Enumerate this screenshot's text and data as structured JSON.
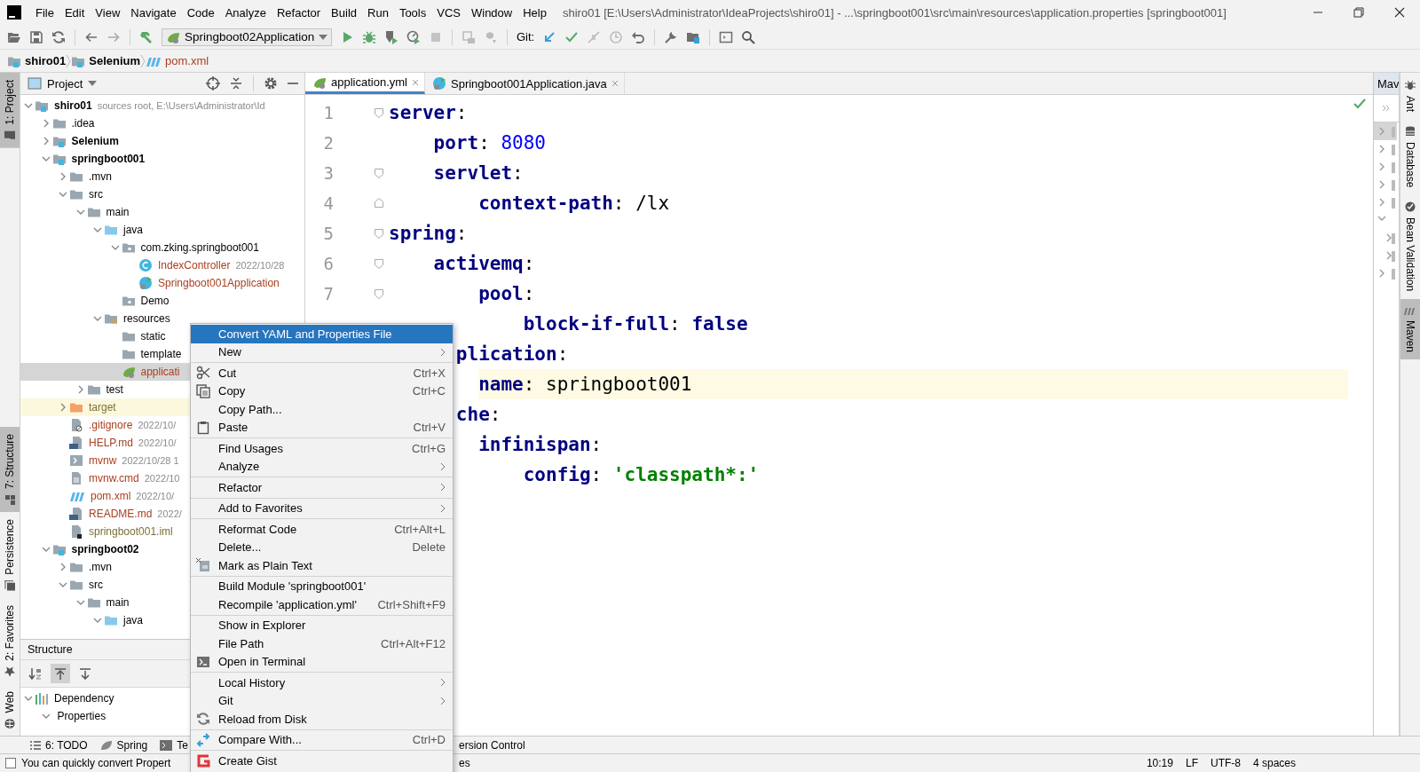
{
  "menu_bar": {
    "items": [
      "File",
      "Edit",
      "View",
      "Navigate",
      "Code",
      "Analyze",
      "Refactor",
      "Build",
      "Run",
      "Tools",
      "VCS",
      "Window",
      "Help"
    ],
    "title": "shiro01 [E:\\Users\\Administrator\\IdeaProjects\\shiro01] - ...\\springboot001\\src\\main\\resources\\application.properties [springboot001]"
  },
  "toolbar": {
    "run_configuration": "Springboot02Application",
    "git_label": "Git:"
  },
  "breadcrumbs": [
    {
      "label": "shiro01",
      "kind": "module"
    },
    {
      "label": "Selenium",
      "kind": "module"
    },
    {
      "label": "pom.xml",
      "kind": "maven"
    }
  ],
  "left_tool_tabs": {
    "top": [
      {
        "label": "1: Project",
        "selected": true
      }
    ],
    "bottom": [
      {
        "label": "7: Structure",
        "selected": true
      },
      {
        "label": "Persistence",
        "selected": false
      },
      {
        "label": "2: Favorites",
        "selected": false
      },
      {
        "label": "Web",
        "selected": false
      }
    ]
  },
  "right_tool_tabs": [
    {
      "label": "Ant",
      "selected": false
    },
    {
      "label": "Database",
      "selected": false
    },
    {
      "label": "Bean Validation",
      "selected": false
    },
    {
      "label": "Maven",
      "selected": true
    }
  ],
  "project_panel": {
    "title": "Project",
    "tree": [
      {
        "label": "shiro01",
        "kind": "module",
        "note": "sources root,  E:\\Users\\Administrator\\Id",
        "expanded": true,
        "selected": false,
        "children": [
          {
            "label": ".idea",
            "kind": "folder",
            "expanded": false,
            "selected": false
          },
          {
            "label": "Selenium",
            "kind": "module",
            "expanded": false,
            "selected": false
          },
          {
            "label": "springboot001",
            "kind": "module",
            "expanded": true,
            "selected": false,
            "children": [
              {
                "label": ".mvn",
                "kind": "folder",
                "expanded": false,
                "selected": false
              },
              {
                "label": "src",
                "kind": "folder",
                "expanded": true,
                "selected": false,
                "children": [
                  {
                    "label": "main",
                    "kind": "folder",
                    "expanded": true,
                    "selected": false,
                    "children": [
                      {
                        "label": "java",
                        "kind": "source",
                        "expanded": true,
                        "selected": false,
                        "children": [
                          {
                            "label": "com.zking.springboot001",
                            "kind": "package",
                            "expanded": true,
                            "selected": false,
                            "children": [
                              {
                                "label": "IndexController",
                                "kind": "class",
                                "color": "#a93f1f",
                                "date": "2022/10/28",
                                "selected": false
                              },
                              {
                                "label": "Springboot001Application",
                                "kind": "app",
                                "color": "#a93f1f",
                                "selected": false
                              }
                            ]
                          },
                          {
                            "label": "Demo",
                            "kind": "package",
                            "selected": false
                          }
                        ]
                      },
                      {
                        "label": "resources",
                        "kind": "resources",
                        "expanded": true,
                        "selected": false,
                        "children": [
                          {
                            "label": "static",
                            "kind": "folder",
                            "selected": false
                          },
                          {
                            "label": "template",
                            "kind": "folder",
                            "selected": false
                          },
                          {
                            "label": "applicati",
                            "kind": "yml",
                            "color": "#a93f1f",
                            "selected": true
                          }
                        ]
                      }
                    ]
                  },
                  {
                    "label": "test",
                    "kind": "folder",
                    "expanded": false,
                    "selected": false
                  }
                ]
              },
              {
                "label": "target",
                "kind": "excluded",
                "color": "#7d6f35",
                "expanded": false,
                "selected": false
              },
              {
                "label": ".gitignore",
                "kind": "gitignore",
                "color": "#a93f1f",
                "date": "2022/10/",
                "selected": false
              },
              {
                "label": "HELP.md",
                "kind": "md",
                "color": "#a93f1f",
                "date": "2022/10/",
                "selected": false
              },
              {
                "label": "mvnw",
                "kind": "mvnw",
                "color": "#a93f1f",
                "date": "2022/10/28 1",
                "selected": false
              },
              {
                "label": "mvnw.cmd",
                "kind": "cmd",
                "color": "#a93f1f",
                "date": "2022/10",
                "selected": false
              },
              {
                "label": "pom.xml",
                "kind": "maven",
                "color": "#a93f1f",
                "date": "2022/10/",
                "selected": false
              },
              {
                "label": "README.md",
                "kind": "md",
                "color": "#a93f1f",
                "date": "2022/",
                "selected": false
              },
              {
                "label": "springboot001.iml",
                "kind": "iml",
                "color": "#7d6f35",
                "selected": false
              }
            ]
          },
          {
            "label": "springboot02",
            "kind": "module",
            "expanded": true,
            "selected": false,
            "children": [
              {
                "label": ".mvn",
                "kind": "folder",
                "expanded": false,
                "selected": false
              },
              {
                "label": "src",
                "kind": "folder",
                "expanded": true,
                "selected": false,
                "children": [
                  {
                    "label": "main",
                    "kind": "folder",
                    "expanded": true,
                    "selected": false,
                    "children": [
                      {
                        "label": "java",
                        "kind": "source",
                        "expanded": true,
                        "selected": false
                      }
                    ]
                  }
                ]
              }
            ]
          }
        ]
      }
    ]
  },
  "structure_panel": {
    "title": "Structure",
    "toolbar": [
      {
        "selected": false
      },
      {
        "selected": true
      },
      {
        "selected": false
      }
    ],
    "tree": [
      {
        "label": "Dependency",
        "kind": "dependency",
        "expanded": true,
        "selected": false,
        "children": [
          {
            "label": "Properties",
            "expanded": true,
            "selected": false
          }
        ]
      }
    ]
  },
  "editor": {
    "tabs": [
      {
        "label": "application.yml",
        "kind": "yml",
        "selected": true
      },
      {
        "label": "Springboot001Application.java",
        "kind": "app",
        "selected": false
      }
    ],
    "lines": [
      {
        "number": "1",
        "fold_marker": {
          "kind": "start"
        },
        "current": false,
        "tokens": [
          {
            "kind": "key",
            "text": "server"
          },
          {
            "kind": "punct",
            "text": ":"
          }
        ],
        "children": [
          {
            "number": "2",
            "current": false,
            "tokens": [
              {
                "kind": "key",
                "text": "port"
              },
              {
                "kind": "punct",
                "text": ": "
              },
              {
                "kind": "number",
                "text": "8080"
              }
            ]
          },
          {
            "number": "3",
            "fold_marker": {
              "kind": "start"
            },
            "current": false,
            "tokens": [
              {
                "kind": "key",
                "text": "servlet"
              },
              {
                "kind": "punct",
                "text": ":"
              }
            ],
            "children": [
              {
                "number": "4",
                "fold_marker": {
                  "kind": "end"
                },
                "current": false,
                "tokens": [
                  {
                    "kind": "key",
                    "text": "context-path"
                  },
                  {
                    "kind": "punct",
                    "text": ": "
                  },
                  {
                    "kind": "plain",
                    "text": "/lx"
                  }
                ]
              }
            ]
          }
        ]
      },
      {
        "number": "5",
        "fold_marker": {
          "kind": "start"
        },
        "current": false,
        "tokens": [
          {
            "kind": "key",
            "text": "spring"
          },
          {
            "kind": "punct",
            "text": ":"
          }
        ],
        "children": [
          {
            "number": "6",
            "fold_marker": {
              "kind": "start"
            },
            "current": false,
            "tokens": [
              {
                "kind": "key",
                "text": "activemq"
              },
              {
                "kind": "punct",
                "text": ":"
              }
            ],
            "children": [
              {
                "number": "7",
                "fold_marker": {
                  "kind": "start"
                },
                "current": false,
                "tokens": [
                  {
                    "kind": "key",
                    "text": "pool"
                  },
                  {
                    "kind": "punct",
                    "text": ":"
                  }
                ],
                "children": [
                  {
                    "current": false,
                    "tokens": [
                      {
                        "kind": "key",
                        "text": "block-if-full"
                      },
                      {
                        "kind": "punct",
                        "text": ": "
                      },
                      {
                        "kind": "keyword",
                        "text": "false"
                      }
                    ]
                  }
                ]
              }
            ]
          },
          {
            "current": false,
            "tokens": [
              {
                "kind": "clipped_key",
                "text": "plication"
              },
              {
                "kind": "punct",
                "text": ":"
              }
            ],
            "children": [
              {
                "current": true,
                "tokens": [
                  {
                    "kind": "key",
                    "text": "name"
                  },
                  {
                    "kind": "punct",
                    "text": ": "
                  },
                  {
                    "kind": "plain",
                    "text": "springboot001"
                  }
                ]
              }
            ]
          },
          {
            "current": false,
            "tokens": [
              {
                "kind": "clipped_key",
                "text": "che"
              },
              {
                "kind": "punct",
                "text": ":"
              }
            ],
            "children": [
              {
                "current": false,
                "tokens": [
                  {
                    "kind": "key",
                    "text": "infinispan"
                  },
                  {
                    "kind": "punct",
                    "text": ":"
                  }
                ],
                "children": [
                  {
                    "current": false,
                    "tokens": [
                      {
                        "kind": "key",
                        "text": "config"
                      },
                      {
                        "kind": "punct",
                        "text": ": "
                      },
                      {
                        "kind": "string",
                        "text": "'classpath*:'"
                      }
                    ]
                  }
                ]
              }
            ]
          }
        ]
      }
    ]
  },
  "maven_panel": {
    "title": "Mav"
  },
  "context_menu": {
    "items": [
      {
        "kind": "item",
        "label": "Convert YAML and Properties File",
        "selected": true,
        "submenu": false
      },
      {
        "kind": "item",
        "label": "New",
        "selected": false,
        "submenu": true
      },
      {
        "kind": "separator"
      },
      {
        "kind": "item",
        "label": "Cut",
        "shortcut": "Ctrl+X",
        "selected": false,
        "submenu": false
      },
      {
        "kind": "item",
        "label": "Copy",
        "shortcut": "Ctrl+C",
        "selected": false,
        "submenu": false
      },
      {
        "kind": "item",
        "label": "Copy Path...",
        "selected": false,
        "submenu": false
      },
      {
        "kind": "item",
        "label": "Paste",
        "shortcut": "Ctrl+V",
        "selected": false,
        "submenu": false
      },
      {
        "kind": "separator"
      },
      {
        "kind": "item",
        "label": "Find Usages",
        "shortcut": "Ctrl+G",
        "selected": false,
        "submenu": false
      },
      {
        "kind": "item",
        "label": "Analyze",
        "selected": false,
        "submenu": true
      },
      {
        "kind": "separator"
      },
      {
        "kind": "item",
        "label": "Refactor",
        "selected": false,
        "submenu": true
      },
      {
        "kind": "separator"
      },
      {
        "kind": "item",
        "label": "Add to Favorites",
        "selected": false,
        "submenu": true
      },
      {
        "kind": "separator"
      },
      {
        "kind": "item",
        "label": "Reformat Code",
        "shortcut": "Ctrl+Alt+L",
        "selected": false,
        "submenu": false
      },
      {
        "kind": "item",
        "label": "Delete...",
        "shortcut": "Delete",
        "selected": false,
        "submenu": false
      },
      {
        "kind": "item",
        "label": "Mark as Plain Text",
        "selected": false,
        "submenu": false
      },
      {
        "kind": "separator"
      },
      {
        "kind": "item",
        "label": "Build Module 'springboot001'",
        "selected": false,
        "submenu": false
      },
      {
        "kind": "item",
        "label": "Recompile 'application.yml'",
        "shortcut": "Ctrl+Shift+F9",
        "selected": false,
        "submenu": false
      },
      {
        "kind": "separator"
      },
      {
        "kind": "item",
        "label": "Show in Explorer",
        "selected": false,
        "submenu": false
      },
      {
        "kind": "item",
        "label": "File Path",
        "shortcut": "Ctrl+Alt+F12",
        "selected": false,
        "submenu": false
      },
      {
        "kind": "item",
        "label": "Open in Terminal",
        "selected": false,
        "submenu": false
      },
      {
        "kind": "separator"
      },
      {
        "kind": "item",
        "label": "Local History",
        "selected": false,
        "submenu": true
      },
      {
        "kind": "item",
        "label": "Git",
        "selected": false,
        "submenu": true
      },
      {
        "kind": "item",
        "label": "Reload from Disk",
        "selected": false,
        "submenu": false
      },
      {
        "kind": "separator"
      },
      {
        "kind": "item",
        "label": "Compare With...",
        "shortcut": "Ctrl+D",
        "selected": false,
        "submenu": false
      },
      {
        "kind": "separator"
      },
      {
        "kind": "item",
        "label": "Create Gist",
        "selected": false,
        "submenu": false
      }
    ]
  },
  "bottom_tool_tabs": {
    "left": [
      {
        "label": "6: TODO"
      },
      {
        "label": "Spring"
      },
      {
        "label": "Te"
      }
    ],
    "right": [
      {
        "label": "ersion Control"
      }
    ]
  },
  "status_bar": {
    "message": "You can quickly convert Propert",
    "message_tail": "es",
    "items": [
      "10:19",
      "LF",
      "UTF-8",
      "4 spaces"
    ]
  }
}
